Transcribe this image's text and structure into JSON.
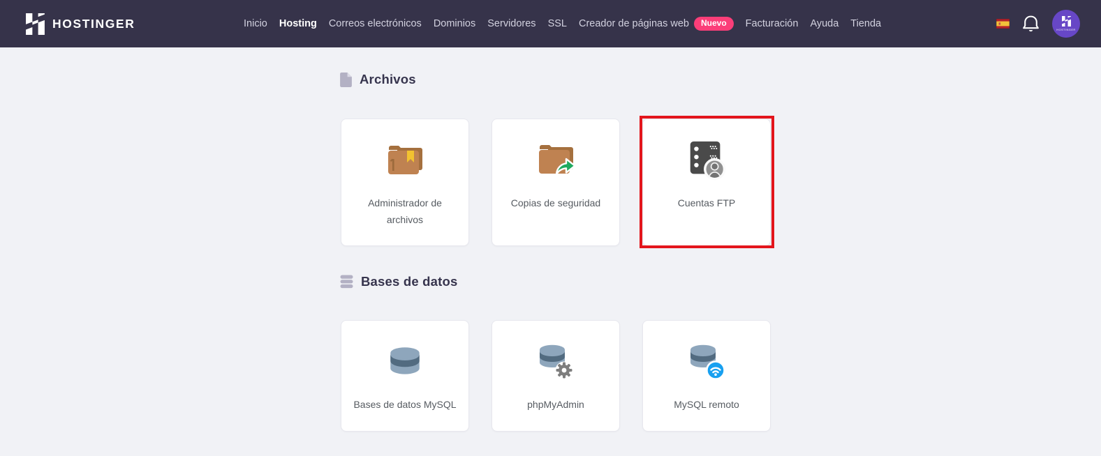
{
  "navbar": {
    "brand": "HOSTINGER",
    "items": [
      {
        "label": "Inicio",
        "active": false
      },
      {
        "label": "Hosting",
        "active": true
      },
      {
        "label": "Correos electrónicos",
        "active": false
      },
      {
        "label": "Dominios",
        "active": false
      },
      {
        "label": "Servidores",
        "active": false
      },
      {
        "label": "SSL",
        "active": false
      },
      {
        "label": "Creador de páginas web",
        "active": false,
        "badge": "Nuevo"
      },
      {
        "label": "Facturación",
        "active": false
      },
      {
        "label": "Ayuda",
        "active": false
      },
      {
        "label": "Tienda",
        "active": false
      }
    ],
    "language": "spain-flag",
    "colors": {
      "background": "#36334a",
      "badge": "#fb3e79",
      "avatar": "#6747c6"
    }
  },
  "sections": [
    {
      "title": "Archivos",
      "icon": "file-icon",
      "cards": [
        {
          "label": "Administrador de archivos",
          "icon": "folder-icon",
          "highlighted": false
        },
        {
          "label": "Copias de seguridad",
          "icon": "folder-share-icon",
          "highlighted": false
        },
        {
          "label": "Cuentas FTP",
          "icon": "ftp-server-icon",
          "highlighted": true
        }
      ]
    },
    {
      "title": "Bases de datos",
      "icon": "database-icon",
      "cards": [
        {
          "label": "Bases de datos MySQL",
          "icon": "mysql-database-icon",
          "highlighted": false
        },
        {
          "label": "phpMyAdmin",
          "icon": "phpmyadmin-icon",
          "highlighted": false
        },
        {
          "label": "MySQL remoto",
          "icon": "mysql-remote-icon",
          "highlighted": false
        }
      ]
    }
  ],
  "highlight_color": "#e3151c"
}
